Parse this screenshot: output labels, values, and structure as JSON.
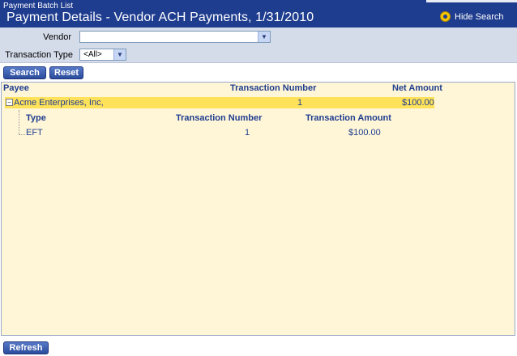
{
  "header": {
    "breadcrumb": "Payment Batch List",
    "title": "Payment Details - Vendor ACH Payments, 1/31/2010",
    "hide_search_label": "Hide Search"
  },
  "search": {
    "vendor_label": "Vendor",
    "vendor_value": "",
    "transaction_type_label": "Transaction Type",
    "transaction_type_value": "<All>",
    "search_button": "Search",
    "reset_button": "Reset"
  },
  "grid": {
    "columns": [
      "Payee",
      "Transaction Number",
      "Net Amount"
    ],
    "rows": [
      {
        "payee": "Acme Enterprises, Inc,",
        "transaction_number": "1",
        "net_amount": "$100.00",
        "detail": {
          "columns": [
            "Type",
            "Transaction Number",
            "Transaction Amount"
          ],
          "rows": [
            {
              "type": "EFT",
              "transaction_number": "1",
              "transaction_amount": "$100.00"
            }
          ]
        }
      }
    ]
  },
  "footer": {
    "refresh_button": "Refresh"
  },
  "colors": {
    "header_bg": "#1f3d8f",
    "search_panel_bg": "#d4dbe9",
    "grid_bg": "#fff6d8",
    "selected_row": "#ffe25a"
  },
  "icons": {
    "hide_search": "search-icon",
    "expand": "collapse-minus-icon",
    "dropdown": "chevron-down-icon"
  }
}
